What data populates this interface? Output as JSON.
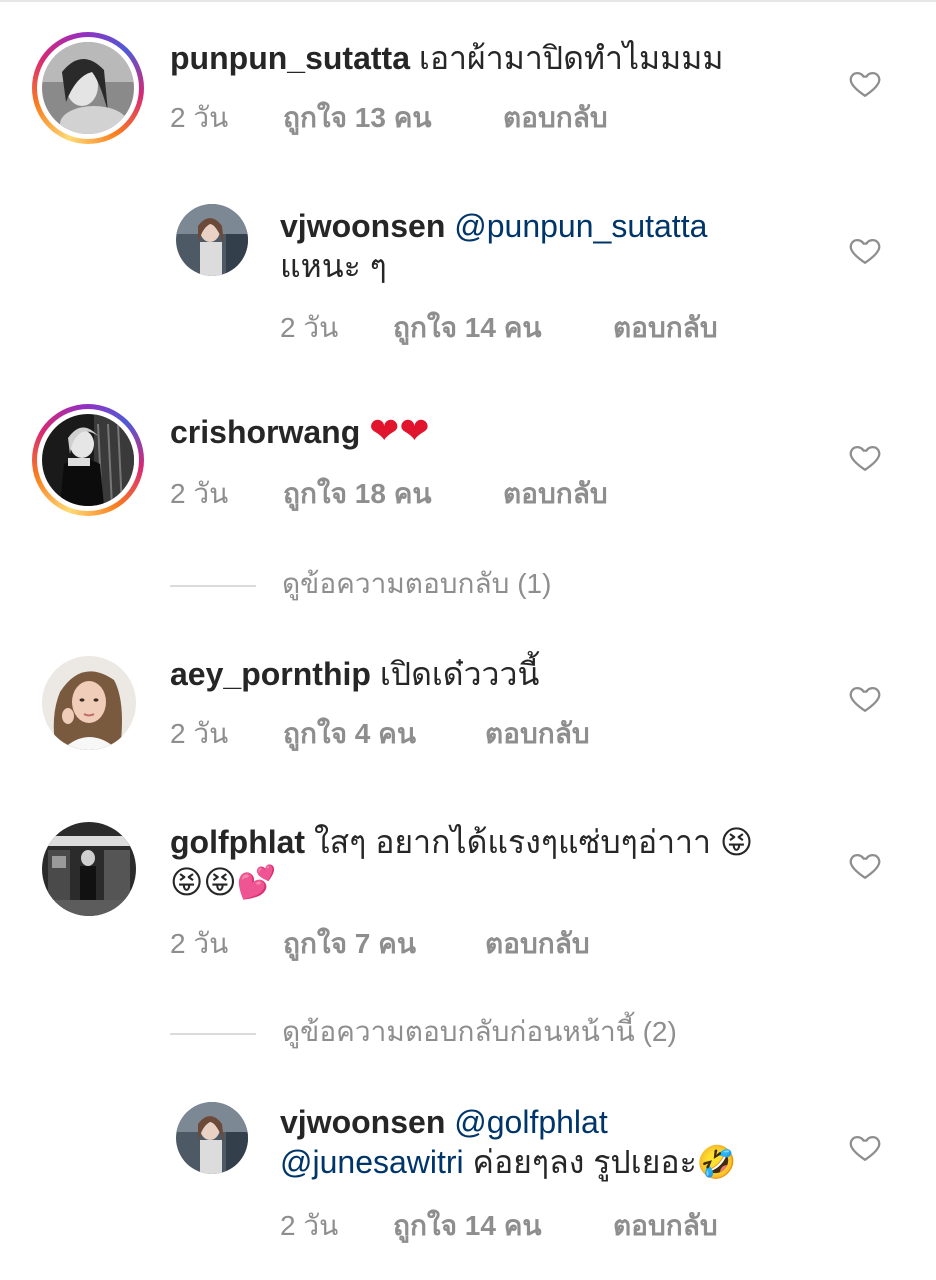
{
  "comments": [
    {
      "username": "punpun_sutatta",
      "text": "เอาผ้ามาปิดทำไมมมม",
      "time": "2 วัน",
      "likes": "ถูกใจ 13 คน",
      "reply": "ตอบกลับ"
    },
    {
      "username": "vjwoonsen",
      "mention": "@punpun_sutatta",
      "text": "แหนะ ๆ",
      "time": "2 วัน",
      "likes": "ถูกใจ 14 คน",
      "reply": "ตอบกลับ"
    },
    {
      "username": "crishorwang",
      "text": "❤❤",
      "time": "2 วัน",
      "likes": "ถูกใจ 18 คน",
      "reply": "ตอบกลับ"
    },
    {
      "username": "aey_pornthip",
      "text": "เปิดเด๋วววนี้",
      "time": "2 วัน",
      "likes": "ถูกใจ 4 คน",
      "reply": "ตอบกลับ"
    },
    {
      "username": "golfphlat",
      "text": "ใสๆ อยากได้แรงๆแซ่บๆอ่าาา 😝",
      "text_line2": "😝😝💕",
      "time": "2 วัน",
      "likes": "ถูกใจ 7 คน",
      "reply": "ตอบกลับ"
    },
    {
      "username": "vjwoonsen",
      "mention": "@golfphlat",
      "mention2": "@junesawitri",
      "text": "ค่อยๆลง รูปเยอะ🤣",
      "time": "2 วัน",
      "likes": "ถูกใจ 14 คน",
      "reply": "ตอบกลับ"
    }
  ],
  "view_replies_1": "ดูข้อความตอบกลับ (1)",
  "view_replies_2": "ดูข้อความตอบกลับก่อนหน้านี้ (2)",
  "icons": {
    "like": "heart-outline-icon"
  },
  "colors": {
    "mention": "#003569",
    "meta": "#8e8e8e",
    "text": "#262626",
    "heart_red": "#e0142d"
  }
}
